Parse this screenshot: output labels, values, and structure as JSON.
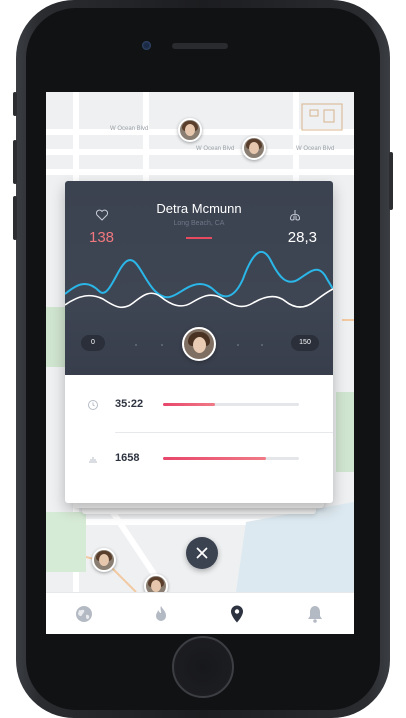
{
  "map": {
    "roads": [
      "W Ocean Blvd",
      "W Ocean Blvd",
      "W Ocean Blvd"
    ]
  },
  "profile": {
    "name": "Detra Mcmunn",
    "location": "Long Beach, CA",
    "heart_rate": "138",
    "breath_rate": "28,3",
    "range_min": "0",
    "range_max": "150"
  },
  "stats": [
    {
      "icon": "clock-icon",
      "value": "35:22",
      "progress": 0.38
    },
    {
      "icon": "distance-icon",
      "value": "1658",
      "progress": 0.76
    }
  ],
  "tabbar": {
    "items": [
      "globe-icon",
      "flame-icon",
      "location-pin-icon",
      "bell-icon"
    ],
    "active_index": 2
  },
  "colors": {
    "accent": "#e84a60",
    "card_dark": "#3b4250",
    "wave_blue": "#2bb6e8",
    "wave_white": "#ffffff"
  }
}
